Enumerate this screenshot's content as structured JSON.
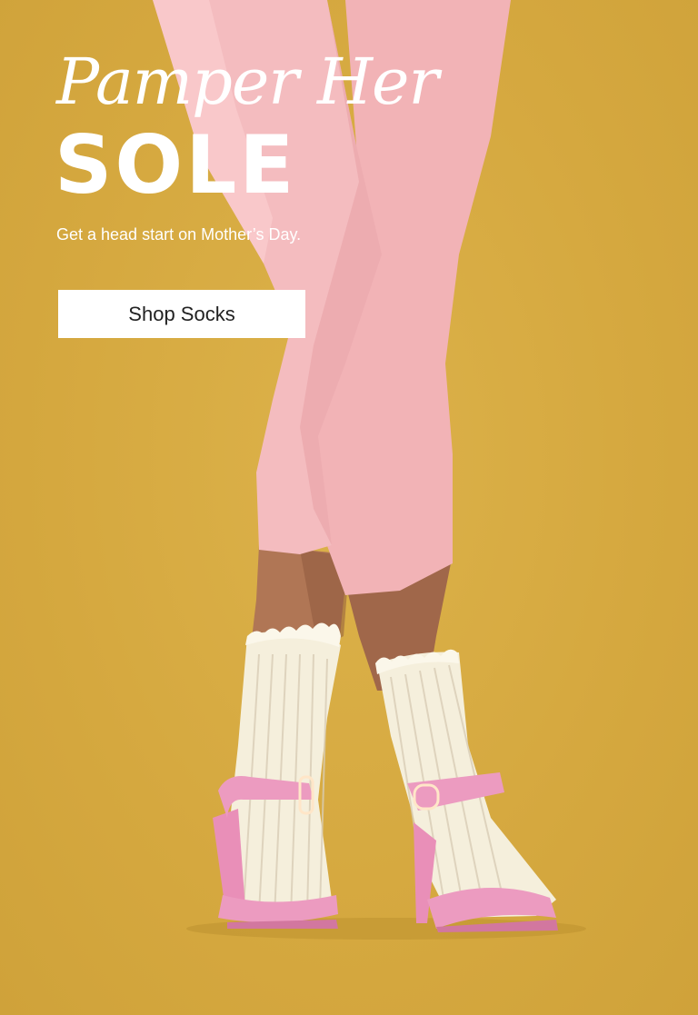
{
  "hero": {
    "headline_script": "Pamper Her",
    "headline_bold": "SOLE",
    "subtitle": "Get a head start on Mother’s Day.",
    "cta_label": "Shop Socks"
  },
  "colors": {
    "background": "#d8ac42",
    "leggings": "#f2b3b6",
    "socks": "#f5efdc",
    "sandals": "#ec9bc0",
    "text": "#ffffff"
  }
}
